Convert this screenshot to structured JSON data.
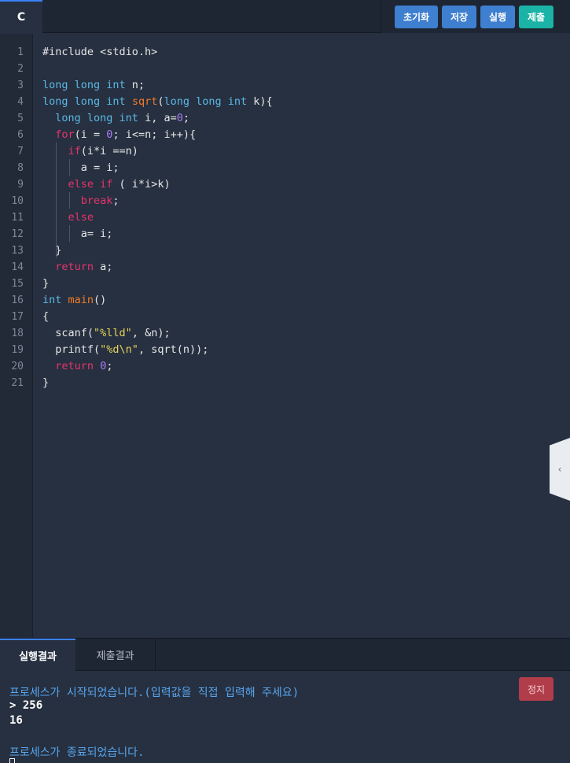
{
  "top": {
    "language_tab": "C",
    "buttons": [
      "초기화",
      "저장",
      "실행",
      "제출"
    ]
  },
  "editor": {
    "line_numbers": [
      "1",
      "2",
      "3",
      "4",
      "5",
      "6",
      "7",
      "8",
      "9",
      "10",
      "11",
      "12",
      "13",
      "14",
      "15",
      "16",
      "17",
      "18",
      "19",
      "20",
      "21"
    ],
    "lines": [
      [
        [
          "plain",
          "#include <stdio.h>"
        ]
      ],
      [],
      [
        [
          "type",
          "long long int"
        ],
        [
          "plain",
          " n;"
        ]
      ],
      [
        [
          "type",
          "long long int"
        ],
        [
          "plain",
          " "
        ],
        [
          "fn",
          "sqrt"
        ],
        [
          "plain",
          "("
        ],
        [
          "type",
          "long long int"
        ],
        [
          "plain",
          " k){"
        ]
      ],
      [
        [
          "plain",
          "  "
        ],
        [
          "type",
          "long long int"
        ],
        [
          "plain",
          " i, a="
        ],
        [
          "num",
          "0"
        ],
        [
          "plain",
          ";"
        ]
      ],
      [
        [
          "plain",
          "  "
        ],
        [
          "kw",
          "for"
        ],
        [
          "plain",
          "(i = "
        ],
        [
          "num",
          "0"
        ],
        [
          "plain",
          "; i<=n; i++){"
        ]
      ],
      [
        [
          "plain",
          "    "
        ],
        [
          "kw",
          "if"
        ],
        [
          "plain",
          "(i*i ==n)"
        ]
      ],
      [
        [
          "plain",
          "      a = i;"
        ]
      ],
      [
        [
          "plain",
          "    "
        ],
        [
          "kw",
          "else if"
        ],
        [
          "plain",
          " ( i*i>k)"
        ]
      ],
      [
        [
          "plain",
          "      "
        ],
        [
          "kw",
          "break"
        ],
        [
          "plain",
          ";"
        ]
      ],
      [
        [
          "plain",
          "    "
        ],
        [
          "kw",
          "else"
        ]
      ],
      [
        [
          "plain",
          "      a= i;"
        ]
      ],
      [
        [
          "plain",
          "  }"
        ]
      ],
      [
        [
          "plain",
          "  "
        ],
        [
          "kw",
          "return"
        ],
        [
          "plain",
          " a;"
        ]
      ],
      [
        [
          "plain",
          "}"
        ]
      ],
      [
        [
          "type",
          "int"
        ],
        [
          "plain",
          " "
        ],
        [
          "fn",
          "main"
        ],
        [
          "plain",
          "()"
        ]
      ],
      [
        [
          "plain",
          "{"
        ]
      ],
      [
        [
          "plain",
          "  scanf("
        ],
        [
          "str",
          "\"%lld\""
        ],
        [
          "plain",
          ", &n);"
        ]
      ],
      [
        [
          "plain",
          "  printf("
        ],
        [
          "str",
          "\"%d\\n\""
        ],
        [
          "plain",
          ", sqrt(n));"
        ]
      ],
      [
        [
          "plain",
          "  "
        ],
        [
          "kw",
          "return"
        ],
        [
          "plain",
          " "
        ],
        [
          "num",
          "0"
        ],
        [
          "plain",
          ";"
        ]
      ],
      [
        [
          "plain",
          "}"
        ]
      ]
    ]
  },
  "panel": {
    "tabs": [
      "실행결과",
      "제출결과"
    ],
    "stop_label": "정지",
    "console_lines": [
      {
        "kind": "info",
        "text": "프로세스가 시작되었습니다.(입력값을 직접 입력해 주세요)"
      },
      {
        "kind": "out",
        "text": "> 256"
      },
      {
        "kind": "out",
        "text": "16"
      },
      {
        "kind": "blank",
        "text": ""
      },
      {
        "kind": "info",
        "text": "프로세스가 종료되었습니다."
      }
    ]
  },
  "icons": {
    "side_handle": "chevron-left-icon"
  },
  "colors": {
    "keyword": "#e8336b",
    "type": "#5cb8e6",
    "function": "#f07a28",
    "number": "#a97df5",
    "string": "#e6d25a",
    "accent": "#3b82f6",
    "teal": "#1ab3a6",
    "stop": "#b23d4a"
  }
}
